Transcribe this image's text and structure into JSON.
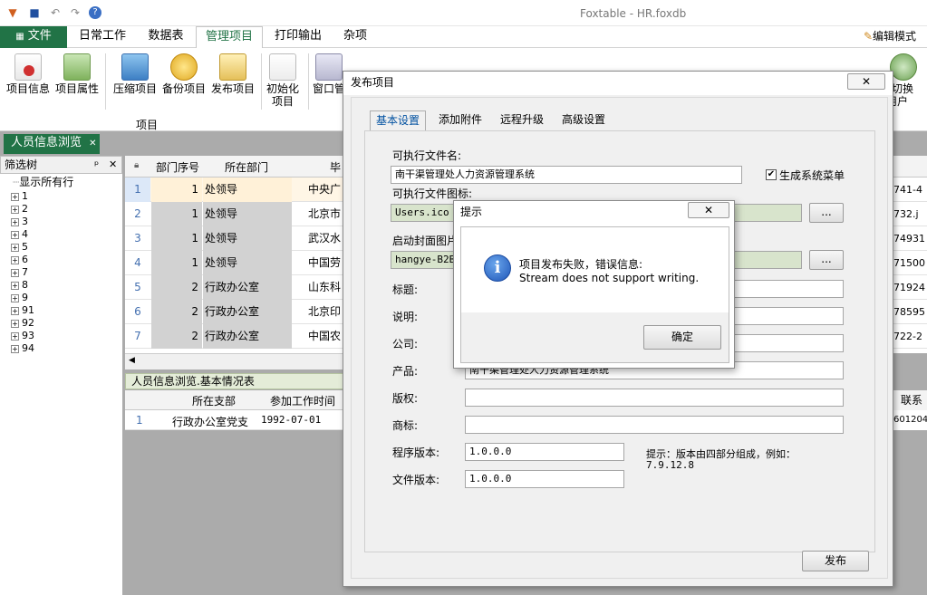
{
  "app": {
    "title": "Foxtable - HR.foxdb",
    "edit_mode": "编辑模式"
  },
  "quick_access": [
    "app-icon",
    "save-icon",
    "undo-icon",
    "redo-icon",
    "help-icon"
  ],
  "tabs": {
    "file": "文件",
    "daily": "日常工作",
    "datatable": "数据表",
    "manage": "管理项目",
    "print": "打印输出",
    "misc": "杂项"
  },
  "ribbon": {
    "buttons": [
      "项目信息",
      "项目属性",
      "压缩项目",
      "备份项目",
      "发布项目",
      "初始化\n项目",
      "窗口管",
      "切换\n用户"
    ],
    "group_label": "项目"
  },
  "doc_tab": {
    "label": "人员信息浏览",
    "close": "✕"
  },
  "filter_tree": {
    "title": "筛选树",
    "pin": "ᵖ",
    "close": "✕",
    "root": "显示所有行",
    "items": [
      "1",
      "2",
      "3",
      "4",
      "5",
      "6",
      "7",
      "8",
      "9",
      "91",
      "92",
      "93",
      "94"
    ]
  },
  "grid": {
    "headers": {
      "seq": "部门序号",
      "dept": "所在部门",
      "grad": "毕"
    },
    "rows": [
      {
        "n": "1",
        "seq": "1",
        "dept": "处领导",
        "u": "中央广"
      },
      {
        "n": "2",
        "seq": "1",
        "dept": "处领导",
        "u": "北京市"
      },
      {
        "n": "3",
        "seq": "1",
        "dept": "处领导",
        "u": "武汉水"
      },
      {
        "n": "4",
        "seq": "1",
        "dept": "处领导",
        "u": "中国劳"
      },
      {
        "n": "5",
        "seq": "2",
        "dept": "行政办公室",
        "u": "山东科"
      },
      {
        "n": "6",
        "seq": "2",
        "dept": "行政办公室",
        "u": "北京印"
      },
      {
        "n": "7",
        "seq": "2",
        "dept": "行政办公室",
        "u": "中国农"
      }
    ],
    "right_cells": [
      "741-4",
      "732.j",
      "74931",
      "71500",
      "71924",
      "78595",
      "722-2"
    ]
  },
  "subtable": {
    "title": "人员信息浏览.基本情况表",
    "headers": {
      "branch": "所在支部",
      "work_time": "参加工作时间",
      "contact": "联系"
    },
    "row": {
      "n": "1",
      "branch": "行政办公室党支",
      "date": "1992-07-01",
      "right": "601204"
    }
  },
  "publish_dialog": {
    "title": "发布项目",
    "tabs": [
      "基本设置",
      "添加附件",
      "远程升级",
      "高级设置"
    ],
    "exe_name_label": "可执行文件名:",
    "exe_name_value": "南干渠管理处人力资源管理系统",
    "gen_menu_label": "生成系统菜单",
    "exe_icon_label": "可执行文件图标:",
    "exe_icon_value": "Users.ico",
    "browse": "...",
    "cover_label": "启动封面图片",
    "cover_value": "hangye-B2BH",
    "title_label": "标题:",
    "desc_label": "说明:",
    "company_label": "公司:",
    "product_label": "产品:",
    "product_value": "南干渠管理处人力资源管理系统",
    "copyright_label": "版权:",
    "trademark_label": "商标:",
    "prog_version_label": "程序版本:",
    "prog_version_value": "1.0.0.0",
    "file_version_label": "文件版本:",
    "file_version_value": "1.0.0.0",
    "hint": "提示：版本由四部分组成，例如：",
    "hint_example": "7.9.12.8",
    "publish_button": "发布",
    "close": "✕"
  },
  "message_box": {
    "title": "提示",
    "line1": "项目发布失败，错误信息:",
    "line2": "Stream does not support writing.",
    "ok": "确定",
    "close": "✕",
    "icon": "i"
  }
}
